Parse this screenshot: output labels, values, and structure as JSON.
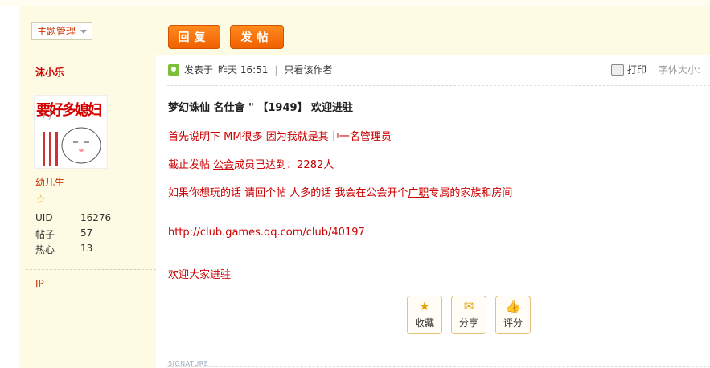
{
  "sidebar": {
    "theme_select": "主题管理",
    "author": "沫小乐",
    "avatar_text": "要好多媳妇",
    "rank": "幼儿生",
    "stats": [
      {
        "label": "UID",
        "value": "16276"
      },
      {
        "label": "帖子",
        "value": "57"
      },
      {
        "label": "热心",
        "value": "13"
      }
    ],
    "ip": "IP"
  },
  "toolbar": {
    "reply": "回复",
    "post": "发帖"
  },
  "meta": {
    "posted_prefix": "发表于",
    "posted_time": "昨天 16:51",
    "separator": "|",
    "only_author": "只看该作者",
    "print": "打印",
    "font_size": "字体大小:"
  },
  "post": {
    "title": "梦幻诛仙  名仕會 \" 【1949】  欢迎进驻",
    "line1_a": "首先说明下    MM很多    因为我就是其中一名",
    "line1_kw": "管理员",
    "line2_a": "截止发帖    ",
    "line2_kw": "公会",
    "line2_b": "成员已达到：2282人",
    "line3_a": "如果你想玩的话   请回个帖    人多的话   我会在公会开个",
    "line3_kw": "广职",
    "line3_b": "专属的家族和房间",
    "url": "http://club.games.qq.com/club/40197",
    "welcome": "欢迎大家进驻"
  },
  "actions": {
    "favorite": "收藏",
    "share": "分享",
    "rate": "评分"
  },
  "signature": "SIGNATURE"
}
